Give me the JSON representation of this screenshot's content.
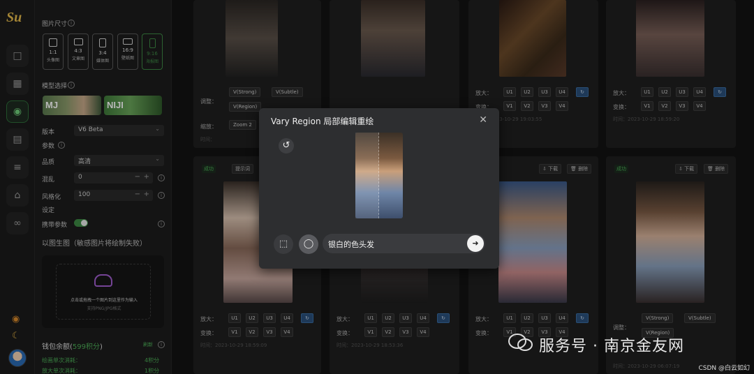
{
  "rail": {
    "logo": "Sи",
    "icons": [
      "chat-icon",
      "grid-icon",
      "palette-icon",
      "wallet-icon",
      "list-icon",
      "cart-icon",
      "share-icon"
    ]
  },
  "panel": {
    "size_label": "图片尺寸",
    "ratios": [
      {
        "r": "1:1",
        "name": "头像图"
      },
      {
        "r": "4:3",
        "name": "文章图"
      },
      {
        "r": "3:4",
        "name": "媒体图"
      },
      {
        "r": "16:9",
        "name": "壁纸图"
      },
      {
        "r": "9:16",
        "name": "海报图"
      }
    ],
    "model_label": "模型选择",
    "model_mj": "MJ",
    "model_niji": "NIJI",
    "version_label": "版本",
    "version_value": "V6 Beta",
    "params_label": "参数",
    "quality_label": "品质",
    "quality_value": "高清",
    "chaos_label": "混乱",
    "chaos_value": "0",
    "stylize_label": "风格化",
    "stylize_value": "100",
    "settings_label": "设定",
    "carry_label": "携带参数",
    "img2img_label": "以图生图（敏感图片将绘制失败）",
    "upload_text": "点击或拖拽一个图片到这里作为输入",
    "upload_sub": "支持PNG/JPG格式",
    "wallet_label": "钱包余额",
    "wallet_value": "599积分",
    "refresh_label": "刷新",
    "cost1_label": "绘画单次消耗：",
    "cost1_value": "4积分",
    "cost2_label": "放大单次消耗：",
    "cost2_value": "1积分"
  },
  "gallery": {
    "adjust_label": "调整：",
    "zoom_label": "缩放：",
    "zoom_chip": "Zoom 2",
    "enlarge_label": "放大：",
    "vary_label": "变换：",
    "u_buttons": [
      "U1",
      "U2",
      "U3",
      "U4"
    ],
    "v_buttons": [
      "V1",
      "V2",
      "V3",
      "V4"
    ],
    "v_strong": "V(Strong)",
    "v_subtle": "V(Subtle)",
    "v_region": "V(Region)",
    "status": "成功",
    "prompt_btn": "提示词",
    "download": "下载",
    "delete": "删除",
    "time_prefix": "时间：",
    "times": [
      "2023-10-29 19:03:55",
      "2023-10-29 18:59:20",
      "2023-10-29 18:59:09",
      "2023-10-29 18:53:36",
      "2023-10-29 06:07:19"
    ]
  },
  "modal": {
    "title": "Vary Region 局部编辑重绘",
    "prompt_value": "银白的色头发"
  },
  "watermark": {
    "text": "服务号 · 南京金友网",
    "csdn": "CSDN @白云如幻"
  }
}
